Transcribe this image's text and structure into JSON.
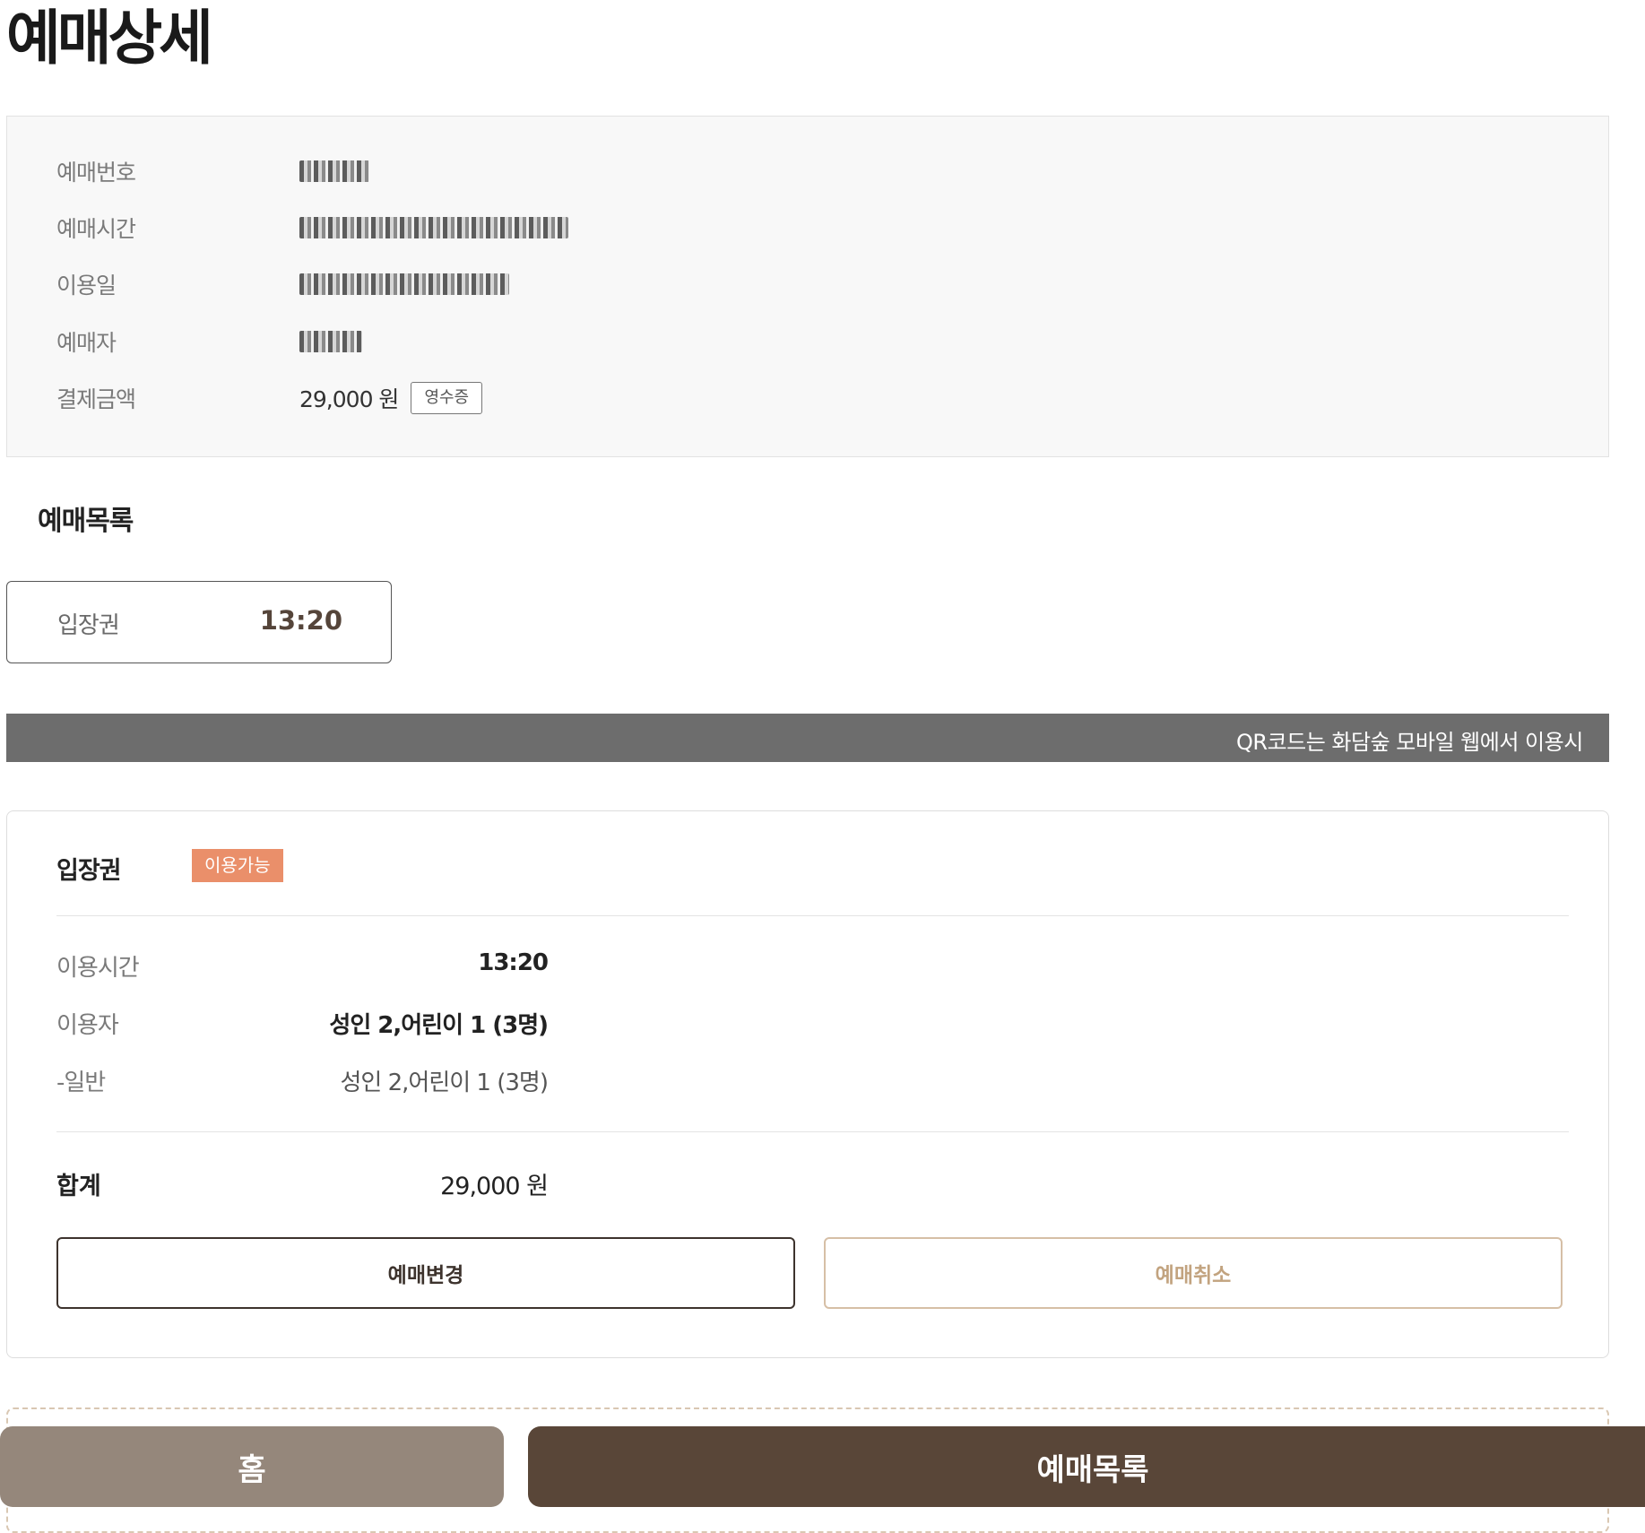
{
  "page": {
    "title": "예매상세"
  },
  "info": {
    "rows": [
      {
        "label": "예매번호"
      },
      {
        "label": "예매시간"
      },
      {
        "label": "이용일"
      },
      {
        "label": "예매자"
      },
      {
        "label": "결제금액",
        "value": "29,000 원"
      }
    ],
    "receipt_button": "영수증"
  },
  "list": {
    "title": "예매목록",
    "ticket": {
      "label": "입장권",
      "time": "13:20"
    }
  },
  "notice": {
    "text": "QR코드는 화담숲 모바일 웹에서 이용시"
  },
  "detail": {
    "title": "입장권",
    "status": "이용가능",
    "rows": [
      {
        "label": "이용시간",
        "value": "13:20"
      },
      {
        "label": "이용자",
        "value": "성인 2,어린이 1 (3명)"
      },
      {
        "label": "-일반",
        "value": "성인 2,어린이 1 (3명)"
      }
    ],
    "total": {
      "label": "합계",
      "value": "29,000 원"
    },
    "change_button": "예매변경",
    "cancel_button": "예매취소"
  },
  "bottom_nav": {
    "home": "홈",
    "list": "예매목록"
  },
  "colors": {
    "brand_dark": "#594638",
    "brand_light": "#95877b",
    "status_available": "#ea8f6a",
    "notice_bg": "#6d6d6d"
  }
}
